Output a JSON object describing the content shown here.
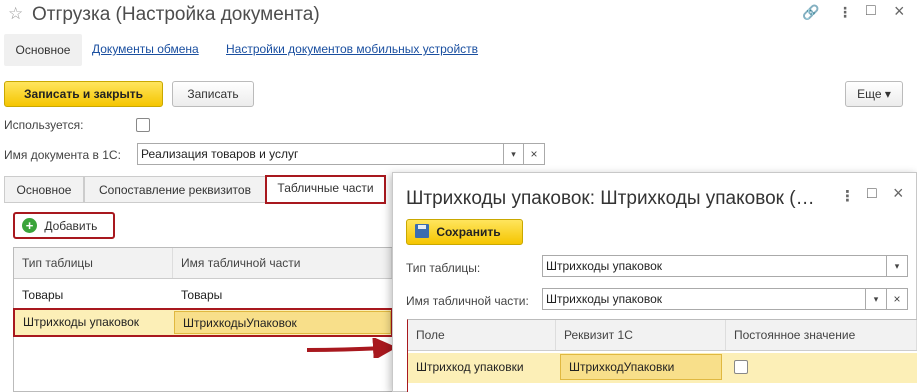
{
  "window": {
    "title": "Отгрузка (Настройка документа)",
    "star_icon": "☆",
    "link_icon": "🔗",
    "menu_icon": "⋮",
    "maximize_icon": "□",
    "close_icon": "×"
  },
  "nav": {
    "tabs": [
      "Основное",
      "Документы обмена",
      "Настройки документов мобильных устройств"
    ]
  },
  "toolbar": {
    "save_close": "Записать и закрыть",
    "save": "Записать",
    "more": "Еще",
    "more_arrow": "▾"
  },
  "fields": {
    "used_label": "Используется:",
    "docname_label": "Имя документа в 1С:",
    "docname_value": "Реализация товаров и услуг",
    "dropdown": "▾",
    "clear": "×"
  },
  "form_tabs": [
    "Основное",
    "Сопоставление реквизитов",
    "Табличные части"
  ],
  "add_button": "Добавить",
  "main_table": {
    "columns": [
      "Тип таблицы",
      "Имя табличной части"
    ],
    "rows": [
      [
        "Товары",
        "Товары"
      ],
      [
        "Штрихкоды упаковок",
        "ШтрихкодыУпаковок"
      ]
    ]
  },
  "dialog": {
    "title": "Штрихкоды упаковок: Штрихкоды упаковок (…",
    "save": "Сохранить",
    "type_label": "Тип таблицы:",
    "type_value": "Штрихкоды упаковок",
    "name_label": "Имя табличной части:",
    "name_value": "Штрихкоды упаковок",
    "table": {
      "columns": [
        "Поле",
        "Реквизит 1С",
        "Постоянное значение"
      ],
      "rows": [
        [
          "Штрихкод упаковки",
          "ШтрихкодУпаковки",
          ""
        ]
      ]
    }
  },
  "colors": {
    "accent_red": "#a8181e",
    "button_yellow": "#f5c500",
    "selection": "#fcefb7",
    "link_blue": "#1a4fa0"
  }
}
